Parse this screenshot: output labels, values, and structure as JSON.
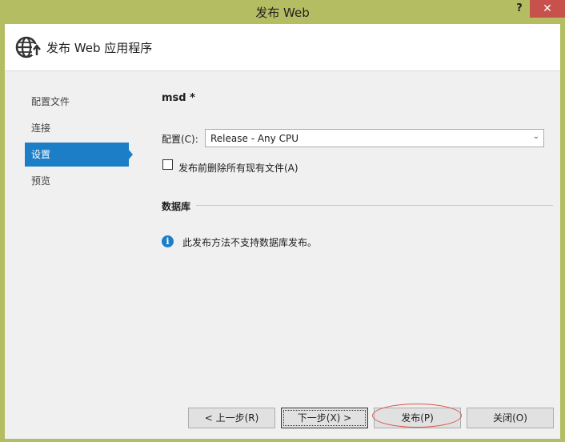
{
  "window": {
    "title": "发布 Web",
    "help_label": "?",
    "close_label": "✕"
  },
  "header": {
    "title": "发布 Web 应用程序",
    "icon": "globe-publish-icon"
  },
  "sidebar": {
    "items": [
      {
        "label": "配置文件",
        "active": false
      },
      {
        "label": "连接",
        "active": false
      },
      {
        "label": "设置",
        "active": true
      },
      {
        "label": "预览",
        "active": false
      }
    ]
  },
  "main": {
    "profile_name": "msd *",
    "config_label": "配置(C):",
    "config_value": "Release - Any CPU",
    "delete_files_label": "发布前删除所有现有文件(A)",
    "delete_files_checked": false,
    "database_section": "数据库",
    "info_text": "此发布方法不支持数据库发布。"
  },
  "buttons": {
    "prev": "< 上一步(R)",
    "next": "下一步(X) >",
    "publish": "发布(P)",
    "close": "关闭(O)"
  },
  "colors": {
    "titlebar": "#b5bd63",
    "accent": "#1c7ec7",
    "close_button": "#c7514b",
    "annotation": "#d9534f"
  }
}
